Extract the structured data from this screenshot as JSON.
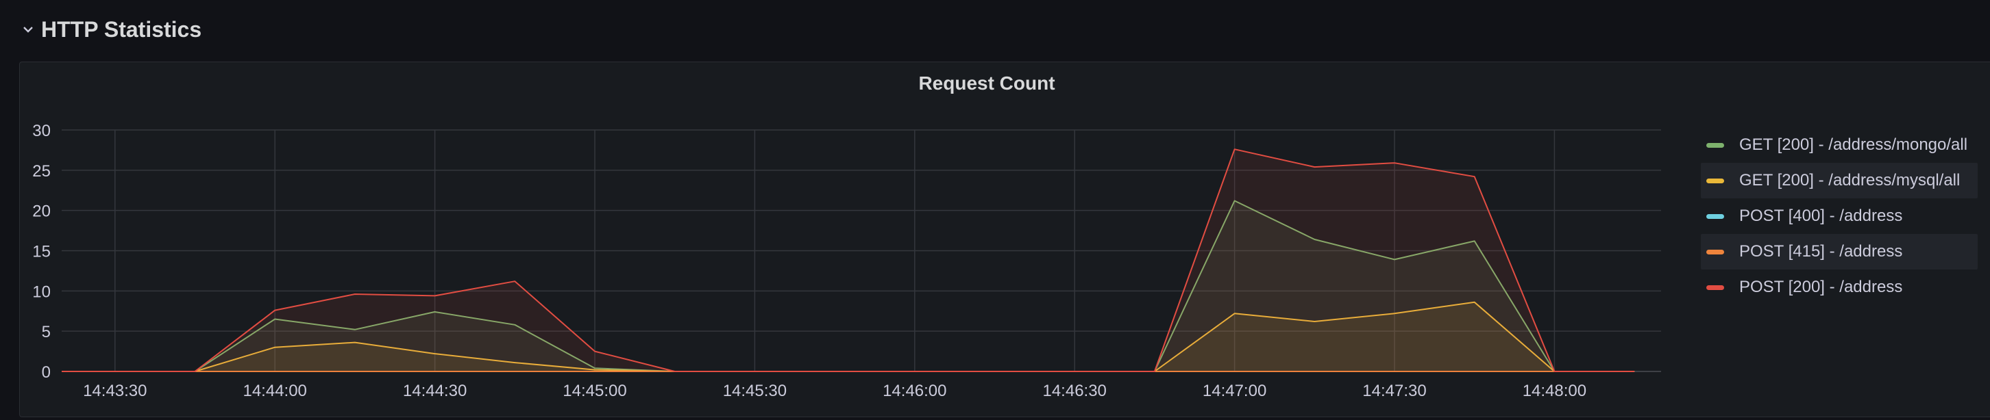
{
  "row": {
    "title": "HTTP Statistics",
    "icon": "chevron-down-icon"
  },
  "panel": {
    "title": "Request Count"
  },
  "chart_data": {
    "type": "line",
    "title": "Request Count",
    "xlabel": "",
    "ylabel": "",
    "grid": true,
    "legend_placement": "right",
    "ylim": [
      0,
      30
    ],
    "y_ticks": [
      "0",
      "5",
      "10",
      "15",
      "20",
      "25",
      "30"
    ],
    "x_range": [
      "14:43:20",
      "14:48:20"
    ],
    "x_ticks": [
      "14:43:30",
      "14:44:00",
      "14:44:30",
      "14:45:00",
      "14:45:30",
      "14:46:00",
      "14:46:30",
      "14:47:00",
      "14:47:30",
      "14:48:00"
    ],
    "x": [
      "14:43:20",
      "14:43:35",
      "14:43:45",
      "14:44:00",
      "14:44:15",
      "14:44:30",
      "14:44:45",
      "14:45:00",
      "14:45:15",
      "14:46:45",
      "14:47:00",
      "14:47:15",
      "14:47:30",
      "14:47:45",
      "14:48:00",
      "14:48:15"
    ],
    "series": [
      {
        "name": "GET [200] - /address/mongo/all",
        "color": "#7eb26d",
        "values": [
          0,
          0,
          0,
          6.5,
          5.2,
          7.4,
          5.8,
          0.4,
          0,
          0,
          21.2,
          16.4,
          13.9,
          16.2,
          0,
          0
        ]
      },
      {
        "name": "GET [200] - /address/mysql/all",
        "color": "#eab839",
        "values": [
          0,
          0,
          0,
          3.0,
          3.6,
          2.2,
          1.1,
          0.2,
          0,
          0,
          7.2,
          6.2,
          7.2,
          8.6,
          0,
          0
        ]
      },
      {
        "name": "POST [400] - /address",
        "color": "#6ed0e0",
        "values": [
          0,
          0,
          0,
          0,
          0,
          0,
          0,
          0,
          0,
          0,
          0,
          0,
          0,
          0,
          0,
          0
        ]
      },
      {
        "name": "POST [415] - /address",
        "color": "#ef843c",
        "values": [
          0,
          0,
          0,
          0,
          0,
          0,
          0,
          0,
          0,
          0,
          0,
          0,
          0,
          0,
          0,
          0
        ]
      },
      {
        "name": "POST [200] - /address",
        "color": "#e24d42",
        "values": [
          0,
          0,
          0,
          7.6,
          9.6,
          9.4,
          11.2,
          2.5,
          0,
          0,
          27.6,
          25.4,
          25.9,
          24.2,
          0,
          0
        ]
      }
    ]
  }
}
